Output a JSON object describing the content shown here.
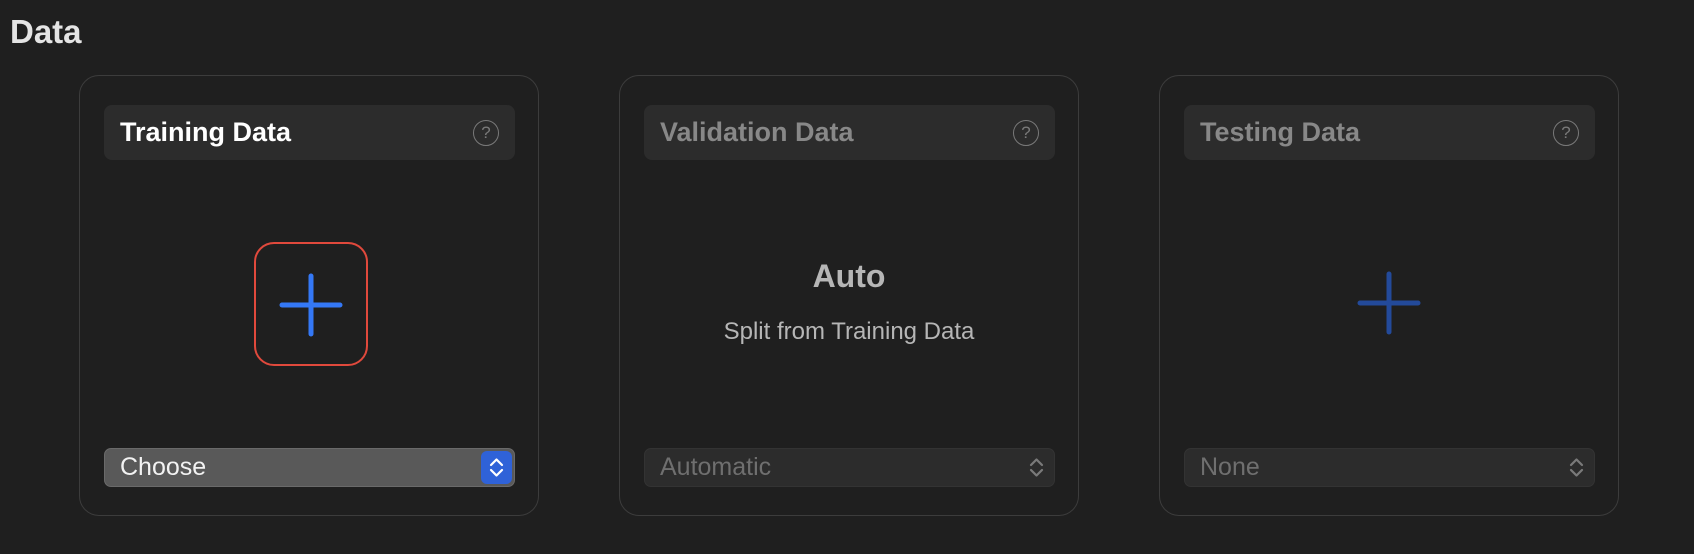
{
  "section": {
    "title": "Data"
  },
  "panels": [
    {
      "header": "Training Data",
      "help_icon": "question-mark-circle-icon",
      "add_icon": "plus-icon",
      "popup": {
        "value": "Choose",
        "enabled": true
      }
    },
    {
      "header": "Validation Data",
      "help_icon": "question-mark-circle-icon",
      "auto_title": "Auto",
      "auto_subtitle": "Split from Training Data",
      "popup": {
        "value": "Automatic",
        "enabled": false
      }
    },
    {
      "header": "Testing Data",
      "help_icon": "question-mark-circle-icon",
      "add_icon": "plus-icon",
      "popup": {
        "value": "None",
        "enabled": false
      }
    }
  ],
  "colors": {
    "background": "#1f1f1f",
    "accent": "#2f62d8",
    "plus_active": "#3478f6",
    "plus_inactive": "#234a9a",
    "highlight": "#e0493c"
  }
}
